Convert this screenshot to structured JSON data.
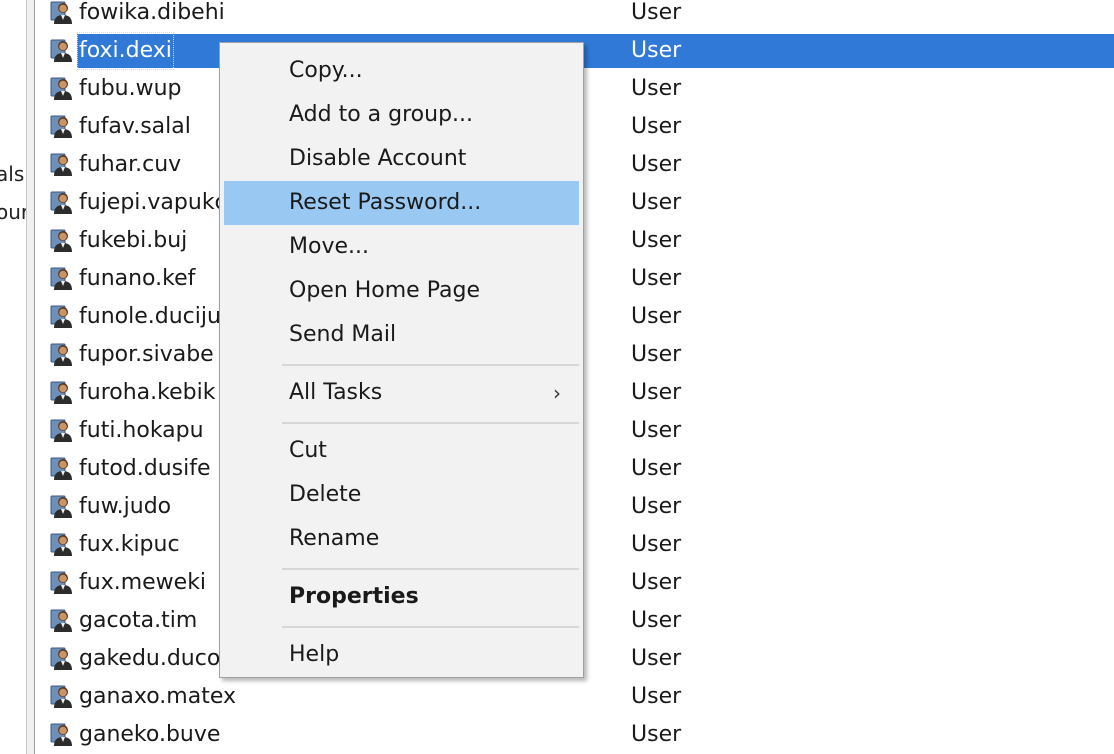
{
  "left_pane": {
    "fragments": [
      "als",
      "our"
    ]
  },
  "users": [
    {
      "name": "fowika.dibehi",
      "type": "User"
    },
    {
      "name": "foxi.dexi",
      "type": "User",
      "selected": true
    },
    {
      "name": "fubu.wup",
      "type": "User"
    },
    {
      "name": "fufav.salal",
      "type": "User"
    },
    {
      "name": "fuhar.cuv",
      "type": "User"
    },
    {
      "name": "fujepi.vapukc",
      "type": "User"
    },
    {
      "name": "fukebi.buj",
      "type": "User"
    },
    {
      "name": "funano.kef",
      "type": "User"
    },
    {
      "name": "funole.duciju",
      "type": "User"
    },
    {
      "name": "fupor.sivabe",
      "type": "User"
    },
    {
      "name": "furoha.kebik",
      "type": "User"
    },
    {
      "name": "futi.hokapu",
      "type": "User"
    },
    {
      "name": "futod.dusife",
      "type": "User"
    },
    {
      "name": "fuw.judo",
      "type": "User"
    },
    {
      "name": "fux.kipuc",
      "type": "User"
    },
    {
      "name": "fux.meweki",
      "type": "User"
    },
    {
      "name": "gacota.tim",
      "type": "User"
    },
    {
      "name": "gakedu.duco",
      "type": "User"
    },
    {
      "name": "ganaxo.matex",
      "type": "User"
    },
    {
      "name": "ganeko.buve",
      "type": "User"
    }
  ],
  "context_menu": {
    "items": [
      {
        "label": "Copy...",
        "id": "copy"
      },
      {
        "label": "Add to a group...",
        "id": "add-to-group"
      },
      {
        "label": "Disable Account",
        "id": "disable-account"
      },
      {
        "label": "Reset Password...",
        "id": "reset-password",
        "highlighted": true
      },
      {
        "label": "Move...",
        "id": "move"
      },
      {
        "label": "Open Home Page",
        "id": "open-home-page"
      },
      {
        "label": "Send Mail",
        "id": "send-mail"
      },
      {
        "separator": true
      },
      {
        "label": "All Tasks",
        "id": "all-tasks",
        "submenu": true
      },
      {
        "separator": true
      },
      {
        "label": "Cut",
        "id": "cut"
      },
      {
        "label": "Delete",
        "id": "delete"
      },
      {
        "label": "Rename",
        "id": "rename"
      },
      {
        "separator": true
      },
      {
        "label": "Properties",
        "id": "properties",
        "bold": true
      },
      {
        "separator": true
      },
      {
        "label": "Help",
        "id": "help"
      }
    ],
    "submenu_arrow": "›"
  },
  "colors": {
    "selection": "#3079d6",
    "menu_hover": "#99c9f3",
    "menu_bg": "#f2f2f2"
  },
  "icons": {
    "user": "user-icon"
  }
}
